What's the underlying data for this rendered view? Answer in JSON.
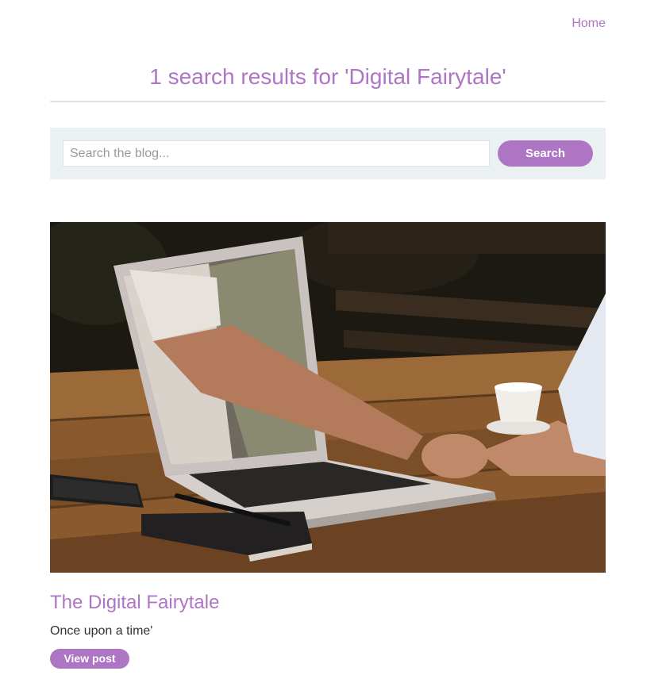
{
  "nav": {
    "home_label": "Home"
  },
  "header": {
    "title": "1 search results for 'Digital Fairytale'"
  },
  "search": {
    "placeholder": "Search the blog...",
    "value": "",
    "button_label": "Search"
  },
  "results": [
    {
      "title": "The Digital Fairytale",
      "summary": "Once upon a time'",
      "button_label": "View post",
      "image_subject": "laptop-handshake-photo"
    }
  ],
  "colors": {
    "accent": "#ae75c5",
    "panel_bg": "#ebf0f2",
    "text": "#333333"
  }
}
